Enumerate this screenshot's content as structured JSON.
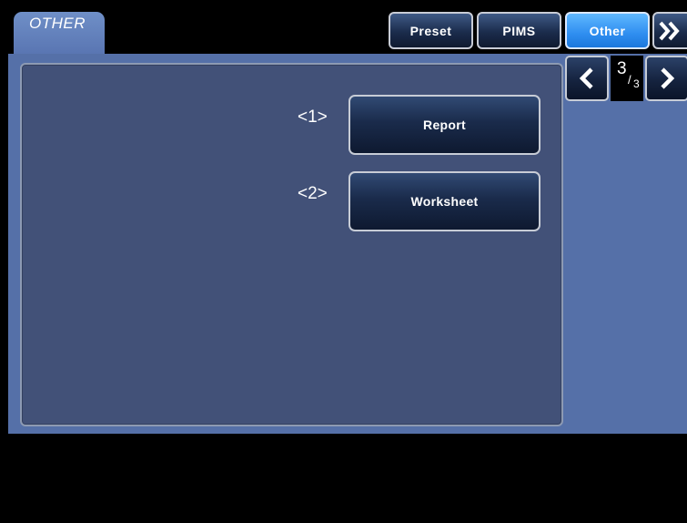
{
  "header": {
    "title": "OTHER",
    "tabs": [
      {
        "label": "Preset",
        "active": false
      },
      {
        "label": "PIMS",
        "active": false
      },
      {
        "label": "Other",
        "active": true
      }
    ],
    "more_icon": "double-chevron-right-icon"
  },
  "items": [
    {
      "index_label": "<1>",
      "button_label": "Report"
    },
    {
      "index_label": "<2>",
      "button_label": "Worksheet"
    }
  ],
  "pager": {
    "current": "3",
    "separator": "/",
    "total": "3",
    "prev_icon": "chevron-left-icon",
    "next_icon": "chevron-right-icon"
  },
  "colors": {
    "panel_bg": "#425178",
    "workarea_bg": "#5570a8",
    "active_tab": "#2f8ef0"
  }
}
